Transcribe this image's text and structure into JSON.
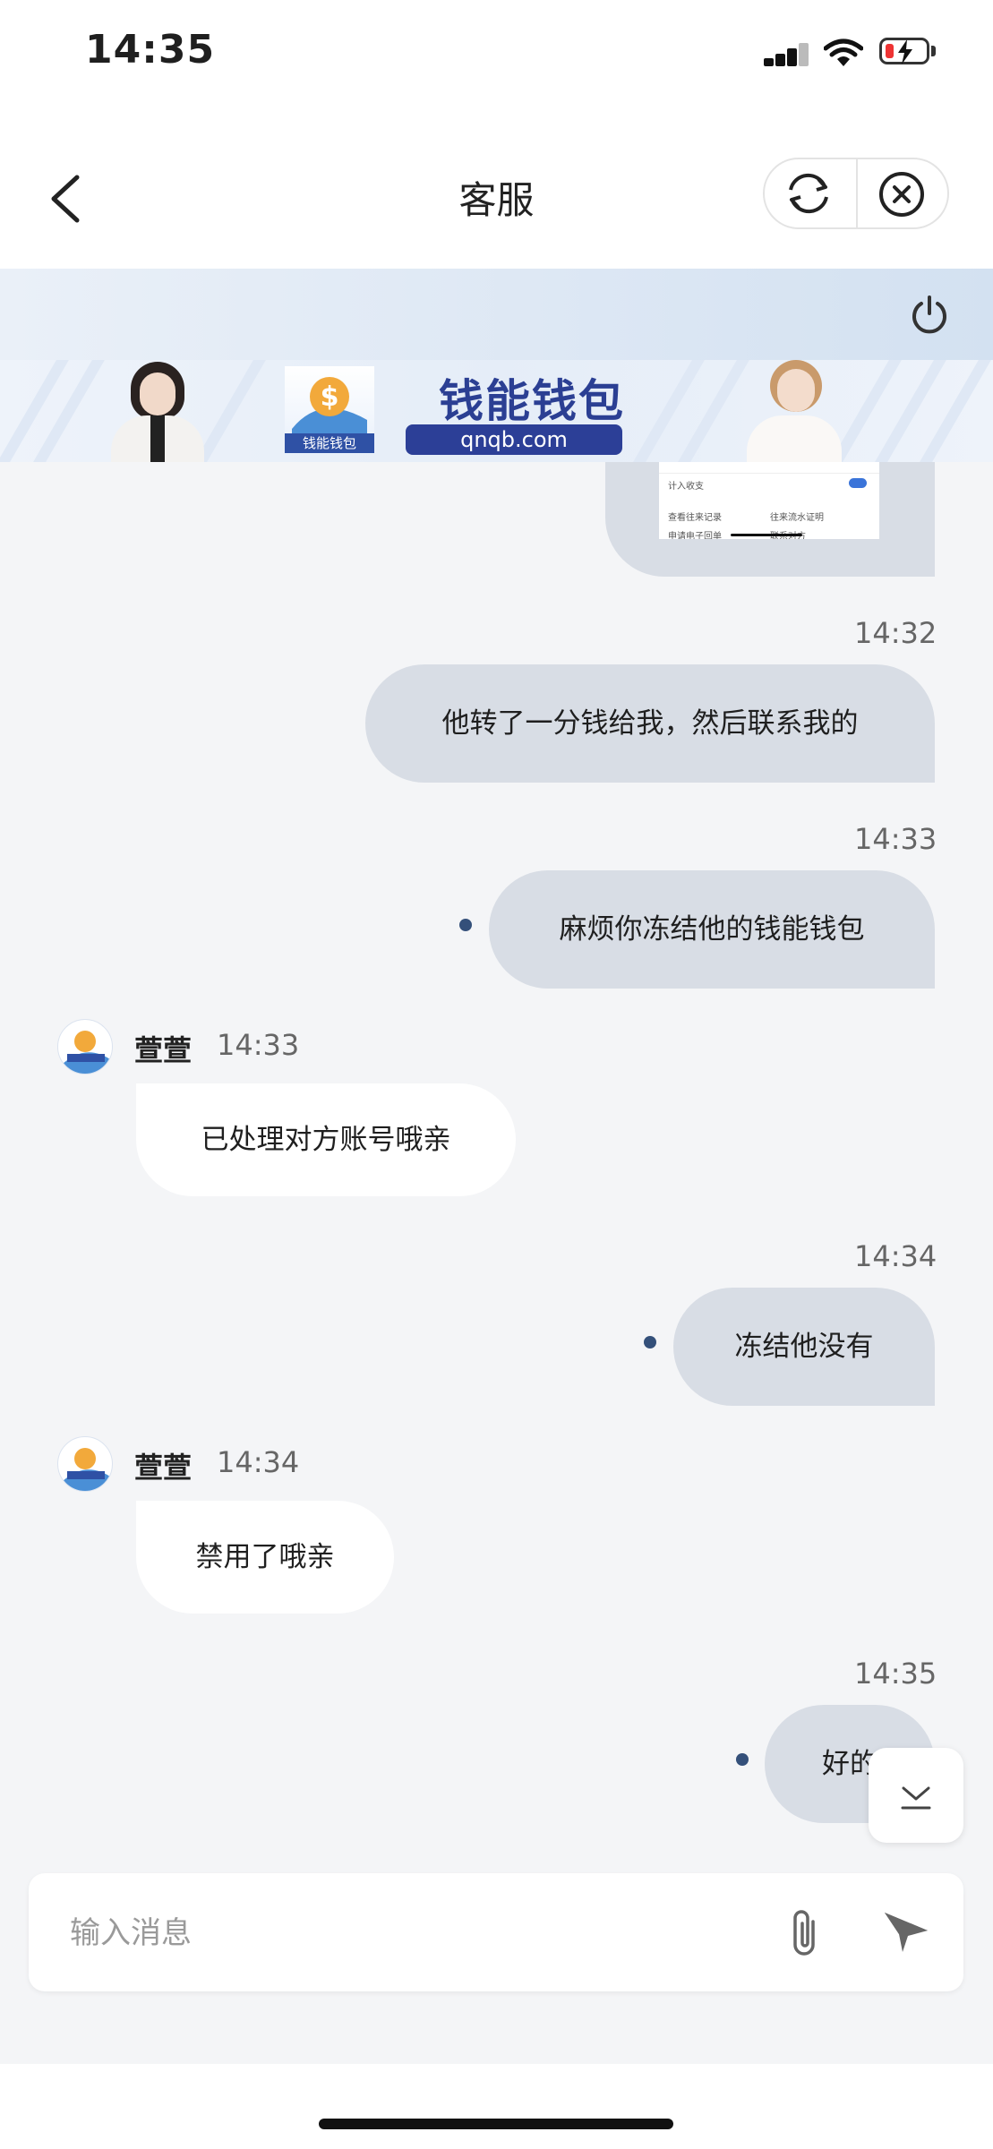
{
  "status_bar": {
    "time": "14:35"
  },
  "nav": {
    "title": "客服",
    "back_icon": "chevron-left-icon",
    "refresh_icon": "refresh-icon",
    "close_icon": "close-circle-icon"
  },
  "header": {
    "power_icon": "power-icon"
  },
  "banner": {
    "brand": "钱能钱包",
    "url": "qnqb.com",
    "logo_caption": "钱能钱包"
  },
  "screenshot_preview": {
    "row1_label": "计入收支",
    "row2_left": "查看往来记录",
    "row2_right": "往来流水证明",
    "row3_left": "申请电子回单",
    "row3_right": "联系对方"
  },
  "messages": [
    {
      "time": "14:32",
      "text": "他转了一分钱给我，然后联系我的"
    },
    {
      "time": "14:33",
      "text": "麻烦你冻结他的钱能钱包"
    },
    {
      "agent": "萱萱",
      "time": "14:33",
      "text": "已处理对方账号哦亲"
    },
    {
      "time": "14:34",
      "text": "冻结他没有"
    },
    {
      "agent": "萱萱",
      "time": "14:34",
      "text": "禁用了哦亲"
    },
    {
      "time": "14:35",
      "text": "好的"
    }
  ],
  "composer": {
    "placeholder": "输入消息",
    "attach_icon": "paperclip-icon",
    "send_icon": "send-icon"
  },
  "scroll_fab_icon": "scroll-to-bottom-icon",
  "colors": {
    "user_bubble": "#d8dde5",
    "agent_bubble": "#ffffff",
    "background": "#f4f5f7",
    "brand": "#2c3f97"
  }
}
